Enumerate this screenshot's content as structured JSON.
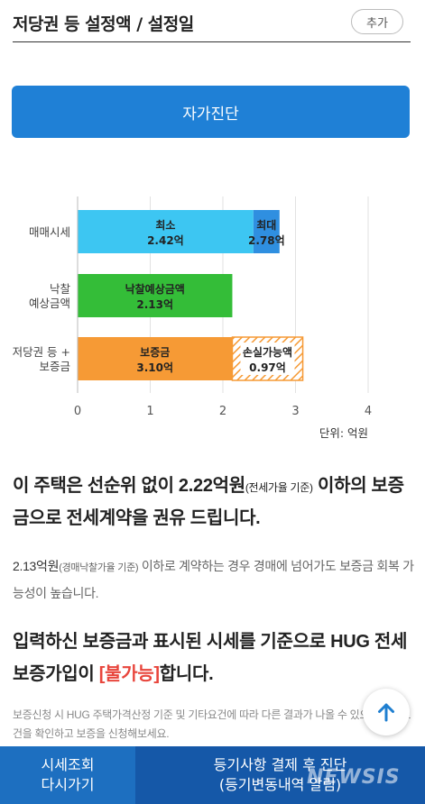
{
  "header": {
    "title": "저당권 등 설정액 / 설정일",
    "add_label": "추가"
  },
  "diagnosis_button": {
    "label": "자가진단"
  },
  "chart_data": {
    "type": "bar",
    "orientation": "horizontal",
    "stacked": true,
    "categories": [
      "매매시세",
      "낙찰\n예상금액",
      "저당권 등 +\n보증금"
    ],
    "segments": [
      {
        "category": "매매시세",
        "name": "최소",
        "value_label": "2.42억",
        "start": 0,
        "end": 2.42,
        "color": "#3dc6f2",
        "hatched": false
      },
      {
        "category": "매매시세",
        "name": "최대",
        "value_label": "2.78억",
        "start": 2.42,
        "end": 2.78,
        "color": "#2f8fe0",
        "hatched": false
      },
      {
        "category": "낙찰\n예상금액",
        "name": "낙찰예상금액",
        "value_label": "2.13억",
        "start": 0,
        "end": 2.13,
        "color": "#34bd38",
        "hatched": false
      },
      {
        "category": "저당권 등 +\n보증금",
        "name": "보증금",
        "value_label": "3.10억",
        "start": 0,
        "end": 2.13,
        "color": "#f69a35",
        "hatched": false
      },
      {
        "category": "저당권 등 +\n보증금",
        "name": "손실가능액",
        "value_label": "0.97억",
        "start": 2.13,
        "end": 3.1,
        "color": "#f69a35",
        "hatched": true
      }
    ],
    "xlim": [
      0,
      4
    ],
    "xticks": [
      "0",
      "1",
      "2",
      "3",
      "4"
    ],
    "unit_label": "단위: 억원",
    "grid": true
  },
  "recommendation": {
    "part1": "이 주택은 선순위 없이 2.22억원",
    "part1_small": "(전세가율 기준)",
    "part1_tail": " 이하의 보증금으로 전세계약을 권유 드립니다."
  },
  "auction_note": {
    "amount": "2.13억원",
    "small": "(경매낙찰가율 기준)",
    "text": " 이하로 계약하는 경우 경매에 넘어가도 보증금 회복 가능성이 높습니다."
  },
  "hug_note": {
    "prefix": "입력하신 보증금과 표시된 시세를 기준으로 HUG 전세보증가입이 ",
    "status": "[불가능]",
    "suffix": "합니다."
  },
  "hug_detail": "보증신청 시 HUG 주택가격산정 기준 및 기타요건에 따라 다른 결과가 나올 수 있으니 가입요건을 확인하고 보증을 신청해보세요.",
  "scroll_top": {
    "icon": "arrow-up-icon"
  },
  "bottom": {
    "left_line1": "시세조회",
    "left_line2": "다시가기",
    "right_line1": "등기사항 결제 후 진단",
    "right_line2": "(등기변동내역 알림)"
  },
  "watermark": "NEWSIS"
}
